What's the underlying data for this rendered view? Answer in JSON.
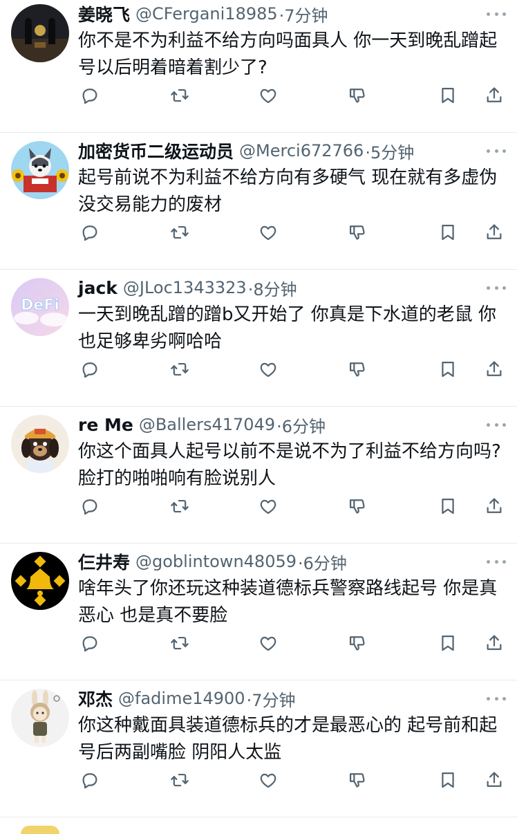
{
  "tweets": [
    {
      "name": "姜晓飞",
      "handle": "@CFergani18985",
      "time": "·7分钟",
      "text": "你不是不为利益不给方向吗面具人 你一天到晚乱蹭起号以后明着暗着割少了?",
      "avatar": "dark-room-avatar"
    },
    {
      "name": "加密货币二级运动员",
      "handle": "@Merci672766",
      "time": "·5分钟",
      "text": "起号前说不为利益不给方向有多硬气 现在就有多虚伪 没交易能力的废材",
      "avatar": "dog-sunflower-avatar"
    },
    {
      "name": "jack",
      "handle": "@JLoc1343323",
      "time": "·8分钟",
      "text": "一天到晚乱蹭的蹭b又开始了 你真是下水道的老鼠 你也足够卑劣啊哈哈",
      "avatar": "defi-cloud-avatar"
    },
    {
      "name": "re Me",
      "handle": "@Ballers417049",
      "time": "·6分钟",
      "text": "你这个面具人起号以前不是说不为了利益不给方向吗? 脸打的啪啪响有脸说别人",
      "avatar": "cartoon-dog-avatar"
    },
    {
      "name": "仨井寿",
      "handle": "@goblintown48059",
      "time": "·6分钟",
      "text": "啥年头了你还玩这种装道德标兵警察路线起号 你是真恶心 也是真不要脸",
      "avatar": "bnb-bell-avatar"
    },
    {
      "name": "邓杰",
      "handle": "@fadime14900",
      "time": "·7分钟",
      "text": "你这种戴面具装道德标兵的才是最恶心的 起号前和起号后两副嘴脸 阴阳人太监",
      "avatar": "bunny-girl-avatar"
    }
  ],
  "colors": {
    "text": "#0f1419",
    "muted": "#536471",
    "icon": "#536471",
    "divider": "#e7e9ea",
    "binance": "#f0b90b"
  }
}
